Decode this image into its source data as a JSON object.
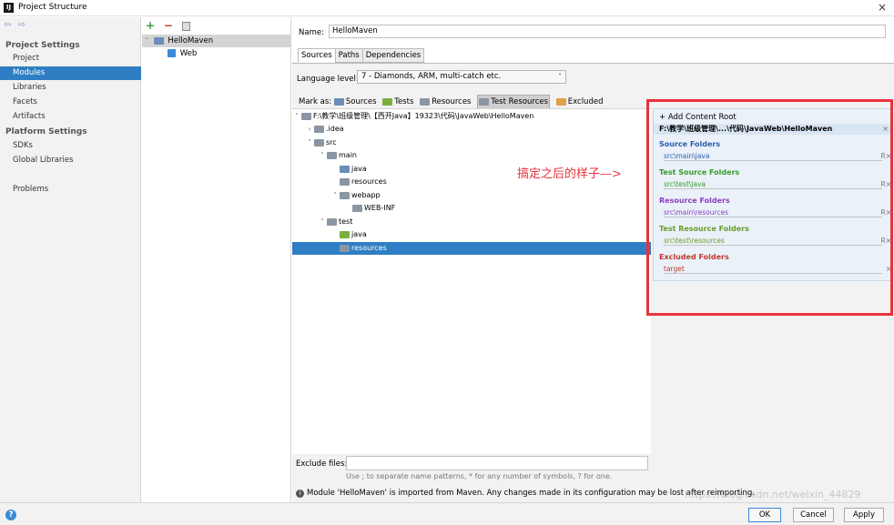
{
  "window": {
    "title": "Project Structure",
    "close": "×",
    "app_icon": "intellij-icon"
  },
  "nav": {
    "back": "⇦",
    "forward": "⇨",
    "project_settings": "Project Settings",
    "project_items": [
      "Project",
      "Modules",
      "Libraries",
      "Facets",
      "Artifacts"
    ],
    "platform_settings": "Platform Settings",
    "platform_items": [
      "SDKs",
      "Global Libraries"
    ],
    "problems": "Problems",
    "selected": "Modules"
  },
  "modules": {
    "toolbar": {
      "add": "+",
      "remove": "−"
    },
    "items": [
      "HelloMaven",
      "Web"
    ]
  },
  "main": {
    "name_label": "Name:",
    "name_value": "HelloMaven",
    "tabs": [
      "Sources",
      "Paths",
      "Dependencies"
    ],
    "active_tab": "Sources",
    "language_label": "Language level:",
    "language_value": "7 - Diamonds, ARM, multi-catch etc.",
    "mark_as_label": "Mark as:",
    "mark_as": [
      "Sources",
      "Tests",
      "Resources",
      "Test Resources",
      "Excluded"
    ],
    "tree": [
      "F:\\教学\\班级管理\\【西开Java】19323\\代码\\JavaWeb\\HelloMaven",
      ".idea",
      "src",
      "main",
      "java",
      "resources",
      "webapp",
      "WEB-INF",
      "test",
      "java",
      "resources"
    ],
    "exclude_label": "Exclude files:",
    "exclude_hint": "Use ; to separate name patterns, * for any number of symbols, ? for one.",
    "info": "Module 'HelloMaven' is imported from Maven. Any changes made in its configuration may be lost after reimporting."
  },
  "roots": {
    "add_root": "+ Add Content Root",
    "root_path": "F:\\教学\\班级管理\\...\\代码\\JavaWeb\\HelloMaven",
    "groups": [
      {
        "title": "Source Folders",
        "path": "src\\main\\java",
        "color": "#2a5db0"
      },
      {
        "title": "Test Source Folders",
        "path": "src\\test\\java",
        "color": "#3a9a2a"
      },
      {
        "title": "Resource Folders",
        "path": "src\\main\\resources",
        "color": "#8a3fc0"
      },
      {
        "title": "Test Resource Folders",
        "path": "src\\test\\resources",
        "color": "#6a9a2a"
      },
      {
        "title": "Excluded Folders",
        "path": "target",
        "color": "#c0392b"
      }
    ],
    "ctl": "R×",
    "close": "×"
  },
  "annotation": "搞定之后的样子—>",
  "buttons": {
    "ok": "OK",
    "cancel": "Cancel",
    "apply": "Apply",
    "help": "?"
  },
  "watermark": "https://blog.csdn.net/weixin_44829"
}
